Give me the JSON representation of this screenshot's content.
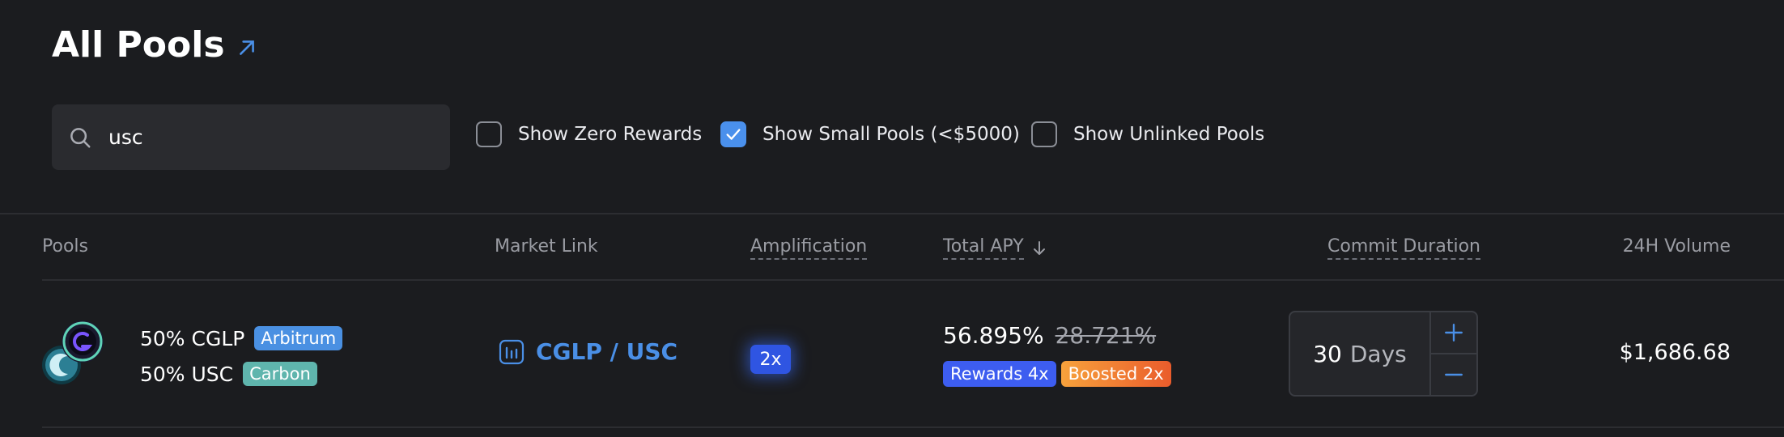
{
  "header": {
    "title": "All Pools"
  },
  "search": {
    "value": "usc"
  },
  "filters": [
    {
      "label": "Show Zero Rewards",
      "checked": false
    },
    {
      "label": "Show Small Pools (<$5000)",
      "checked": true
    },
    {
      "label": "Show Unlinked Pools",
      "checked": false
    }
  ],
  "table": {
    "columns": [
      "Pools",
      "Market Link",
      "Amplification",
      "Total APY",
      "Commit Duration",
      "24H Volume"
    ],
    "rows": [
      {
        "tokens": [
          {
            "share": "50% CGLP",
            "chain": "Arbitrum"
          },
          {
            "share": "50% USC",
            "chain": "Carbon"
          }
        ],
        "market_link": "CGLP / USC",
        "amplification": "2x",
        "total_apy": "56.895%",
        "base_apy": "28.721%",
        "rewards_badge": "Rewards 4x",
        "boosted_badge": "Boosted 2x",
        "commit_value": "30",
        "commit_unit": "Days",
        "volume_24h": "$1,686.68"
      }
    ]
  },
  "colors": {
    "accent": "#4a90ec",
    "background": "#1b1c1f",
    "amp_badge": "#2f55e2",
    "rewards": "#3d5df0",
    "boosted": "#ea5c2c"
  }
}
